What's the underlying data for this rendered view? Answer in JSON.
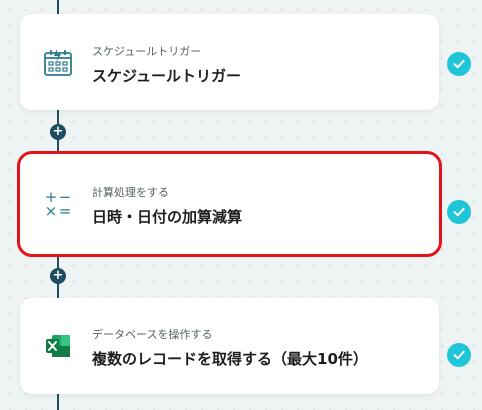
{
  "steps": [
    {
      "subtitle": "スケジュールトリガー",
      "title": "スケジュールトリガー",
      "icon": "schedule-calendar-icon",
      "completed": true
    },
    {
      "subtitle": "計算処理をする",
      "title": "日時・日付の加算減算",
      "icon": "calculator-icon",
      "completed": true,
      "selected": true
    },
    {
      "subtitle": "データベースを操作する",
      "title": "複数のレコードを取得する（最大10件）",
      "icon": "excel-icon",
      "completed": true
    }
  ],
  "calc_symbols": [
    "+",
    "−",
    "×",
    "="
  ],
  "plus_glyph": "+",
  "colors": {
    "connector": "#1f4f5f",
    "check": "#1ec6d8",
    "selection": "#e3131b",
    "excel_green": "#107c41"
  }
}
